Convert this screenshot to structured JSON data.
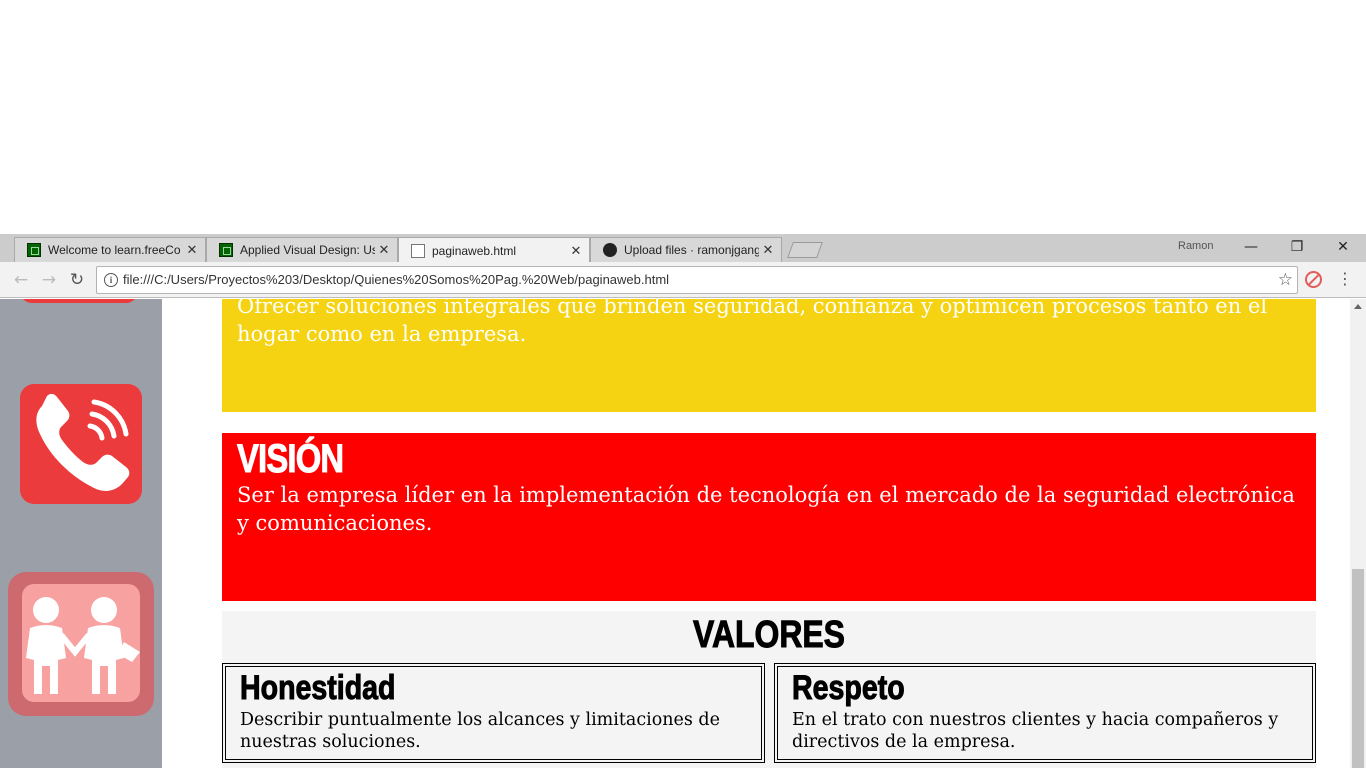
{
  "browser": {
    "tabs": [
      {
        "title": "Welcome to learn.freeCo",
        "icon": "freecodecamp-icon"
      },
      {
        "title": "Applied Visual Design: Us",
        "icon": "freecodecamp-icon"
      },
      {
        "title": "paginaweb.html",
        "icon": "document-icon",
        "active": true
      },
      {
        "title": "Upload files · ramonjgang",
        "icon": "github-icon"
      }
    ],
    "close_glyph": "✕",
    "profile_name": "Ramon",
    "url": "file:///C:/Users/Proyectos%203/Desktop/Quienes%20Somos%20Pag.%20Web/paginaweb.html",
    "window_controls": {
      "minimize": "—",
      "restore": "❐",
      "close": "✕"
    },
    "nav": {
      "back": "←",
      "forward": "→",
      "reload": "↻"
    },
    "star": "☆",
    "menu": "⋮"
  },
  "page": {
    "colors": {
      "sidebar": "#9b9fa8",
      "mision": "#f5d312",
      "vision": "#ff0000",
      "icon_red": "#ec3b3d",
      "valores_bg": "#f4f4f4"
    },
    "mision": {
      "text": "Ofrecer soluciones integrales que brinden seguridad, confianza y optimicen procesos tanto en el hogar como en la empresa."
    },
    "vision": {
      "title": "VISIÓN",
      "text": "Ser la empresa líder en la implementación de tecnología en el mercado de la seguridad electrónica y comunicaciones."
    },
    "valores": {
      "title": "VALORES",
      "items": [
        {
          "title": "Honestidad",
          "text": "Describir puntualmente los alcances y limitaciones de nuestras soluciones."
        },
        {
          "title": "Respeto",
          "text": "En el trato con nuestros clientes y hacia compañeros y directivos de la empresa."
        }
      ]
    }
  }
}
